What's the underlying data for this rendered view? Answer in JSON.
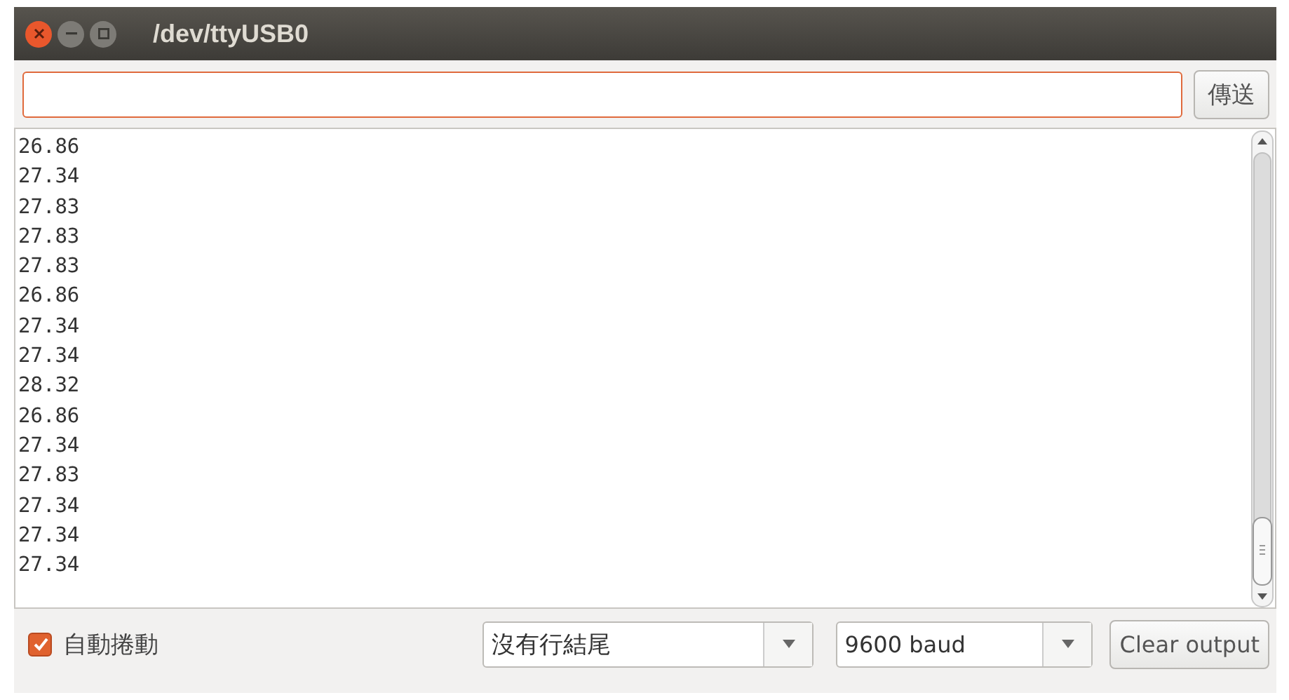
{
  "window": {
    "title": "/dev/ttyUSB0"
  },
  "send": {
    "button": "傳送"
  },
  "output": {
    "lines": [
      "26.86",
      "27.34",
      "27.83",
      "27.83",
      "27.83",
      "26.86",
      "27.34",
      "27.34",
      "28.32",
      "26.86",
      "27.34",
      "27.83",
      "27.34",
      "27.34",
      "27.34"
    ]
  },
  "footer": {
    "autoscroll": {
      "label": "自動捲動",
      "checked": true
    },
    "line_ending": "沒有行結尾",
    "baud": "9600 baud",
    "clear_button": "Clear output"
  }
}
